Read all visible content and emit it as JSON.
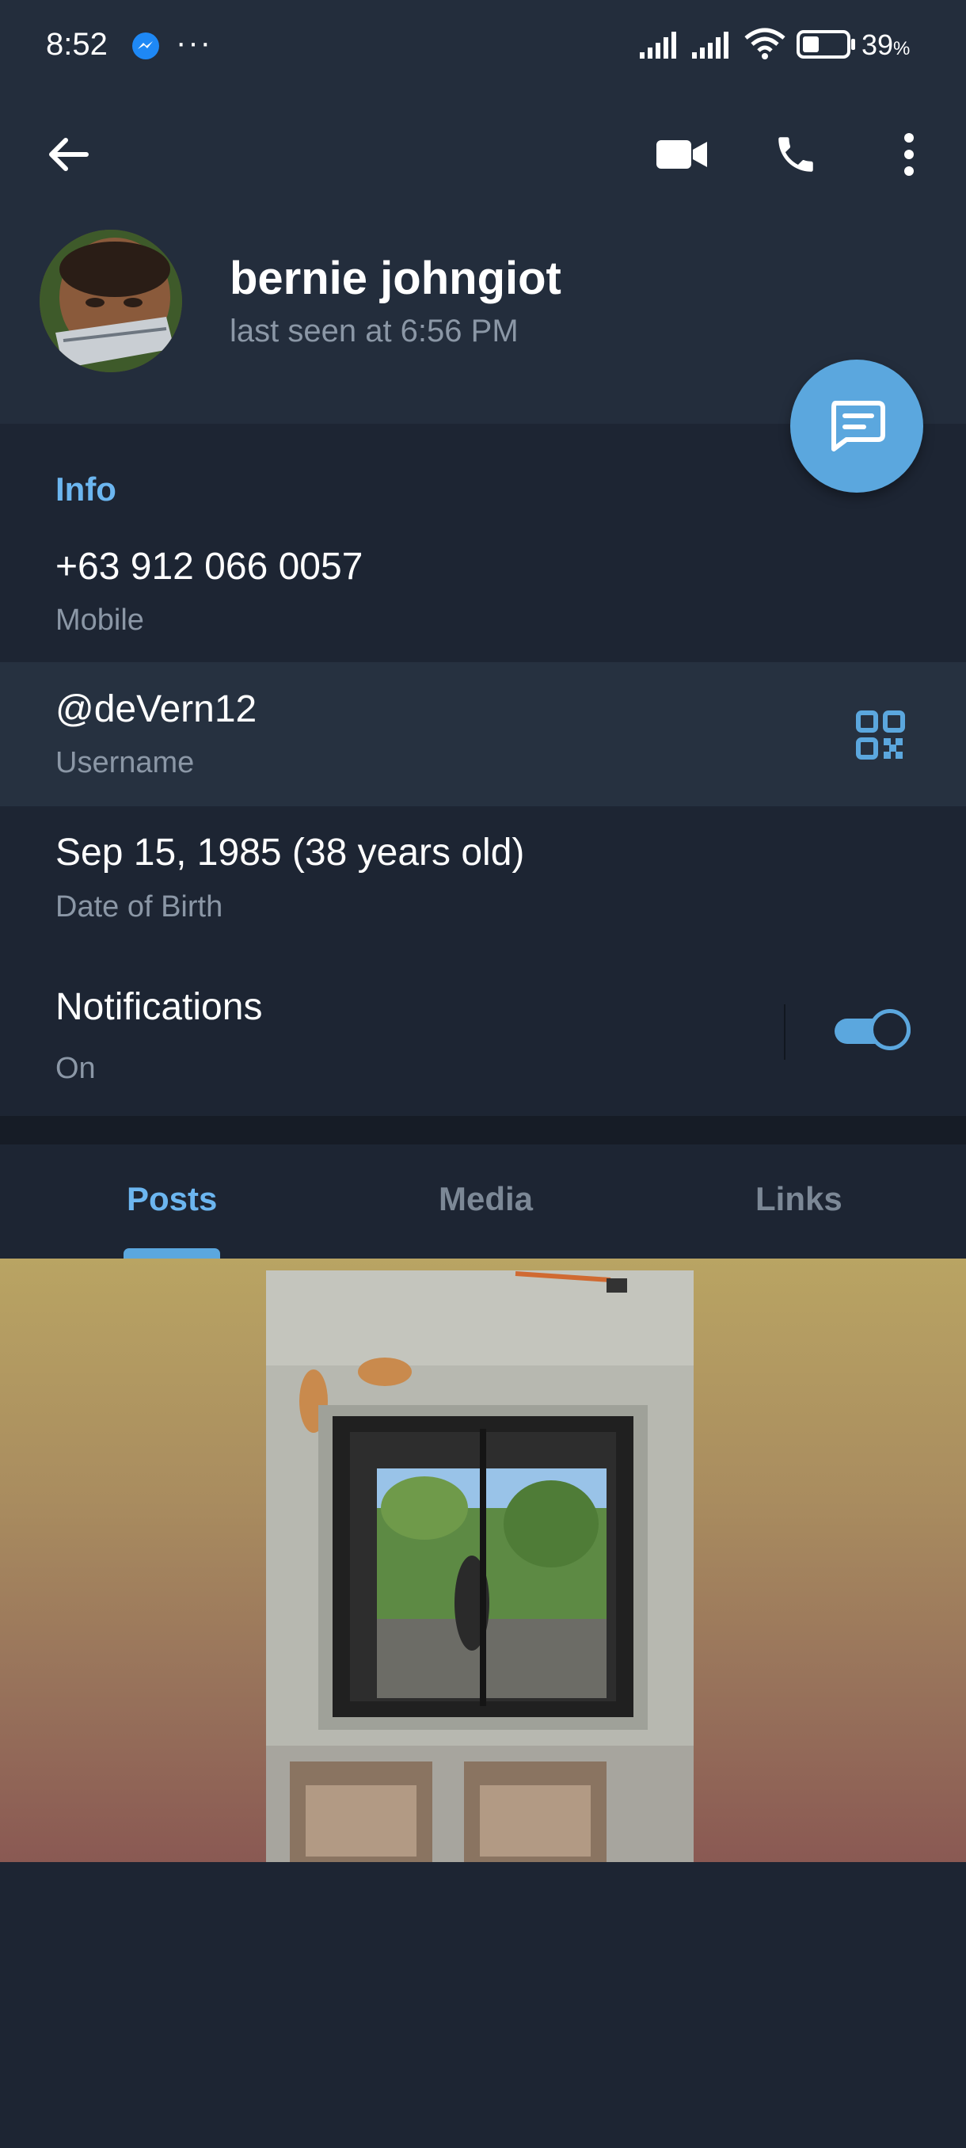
{
  "status_bar": {
    "time": "8:52",
    "dots": "···",
    "battery_percent": "39",
    "battery_unit": "%",
    "battery_level": 0.39,
    "icons": [
      "messenger-icon",
      "signal-icon",
      "signal-icon",
      "wifi-icon",
      "battery-icon"
    ]
  },
  "toolbar": {
    "icons": [
      "back-arrow-icon",
      "video-call-icon",
      "phone-icon",
      "more-vert-icon"
    ]
  },
  "profile": {
    "name": "bernie johngiot",
    "last_seen": "last seen at 6:56 PM"
  },
  "fab": {
    "icon": "message-icon"
  },
  "info": {
    "heading": "Info",
    "phone": {
      "value": "+63 912 066 0057",
      "label": "Mobile"
    },
    "username": {
      "value": "@deVern12",
      "label": "Username",
      "icon": "qr-code-icon"
    },
    "birthday": {
      "value": "Sep 15, 1985 (38 years old)",
      "label": "Date of Birth"
    },
    "notifications": {
      "value": "Notifications",
      "label": "On",
      "enabled": true
    }
  },
  "tabs": [
    {
      "label": "Posts",
      "active": true
    },
    {
      "label": "Media",
      "active": false
    },
    {
      "label": "Links",
      "active": false
    }
  ],
  "colors": {
    "accent": "#5ba7de",
    "header_bg": "#232d3c",
    "body_bg": "#1d2533",
    "muted_text": "#8b97a6"
  }
}
